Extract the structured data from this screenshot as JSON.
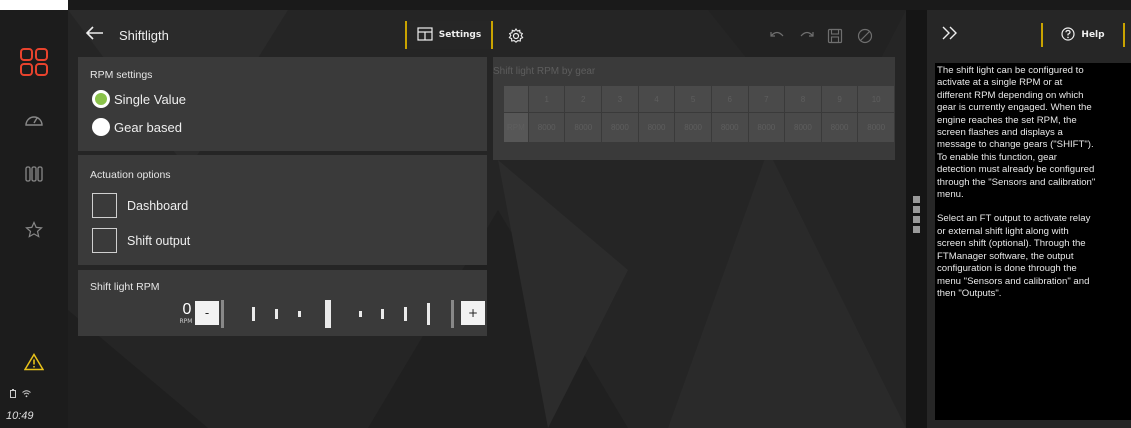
{
  "app": {
    "clock": "10:49"
  },
  "header": {
    "title": "Shiftligth",
    "settings_label": "Settings"
  },
  "rpm_settings": {
    "title": "RPM settings",
    "options": [
      {
        "label": "Single Value",
        "selected": true
      },
      {
        "label": "Gear based",
        "selected": false
      }
    ]
  },
  "actuation": {
    "title": "Actuation options",
    "options": [
      {
        "label": "Dashboard",
        "checked": false
      },
      {
        "label": "Shift output",
        "checked": false
      }
    ]
  },
  "shift_rpm": {
    "title": "Shift light RPM",
    "value": "0",
    "unit": "RPM",
    "minus_label": "-",
    "plus_label": "+"
  },
  "gear_table": {
    "title": "Shift light RPM by gear",
    "row_label": "RPM",
    "gears": [
      "1",
      "2",
      "3",
      "4",
      "5",
      "6",
      "7",
      "8",
      "9",
      "10"
    ],
    "values": [
      "8000",
      "8000",
      "8000",
      "8000",
      "8000",
      "8000",
      "8000",
      "8000",
      "8000",
      "8000"
    ],
    "disabled": true
  },
  "help": {
    "button_label": "Help",
    "paragraphs": [
      "The shift light can be configured to\nactivate at a single RPM or at\ndifferent RPM depending on which\ngear is currently engaged. When the\nengine reaches the set RPM, the\nscreen flashes and displays a\nmessage to change gears (\"SHIFT\").\nTo enable this function, gear\ndetection must already be configured\nthrough the \"Sensors and calibration\"\nmenu.",
      "Select an FT output to activate relay\nor external shift light along with\nscreen shift (optional). Through the\nFTManager software, the output\nconfiguration is done through the\nmenu \"Sensors and calibration\" and\nthen \"Outputs\"."
    ]
  },
  "colors": {
    "accent": "#c9a300",
    "brand": "#e8432d",
    "selected_radio": "#8ac24a",
    "warning": "#e8c21a"
  },
  "icons": {
    "sidebar": [
      "dashboards-grid-icon",
      "gauge-icon",
      "columns-icon",
      "star-icon"
    ],
    "status": [
      "warning-icon",
      "battery-icon",
      "wifi-icon"
    ],
    "toolbar": [
      "settings-grid-icon",
      "gear-icon",
      "undo-icon",
      "redo-icon",
      "save-icon",
      "disabled-icon"
    ]
  }
}
